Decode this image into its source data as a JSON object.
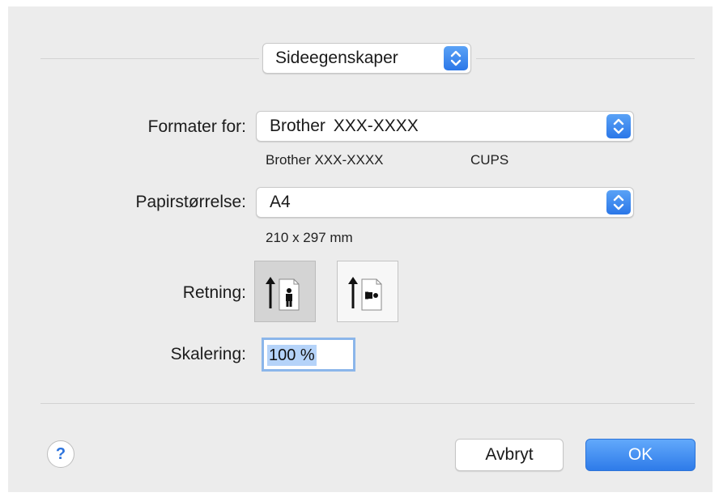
{
  "header": {
    "dropdown_label": "Sideegenskaper"
  },
  "format_for": {
    "label": "Formater for:",
    "value_brand": "Brother",
    "value_model": "XXX-XXXX",
    "subtitle_device": "Brother XXX-XXXX",
    "subtitle_driver": "CUPS"
  },
  "paper_size": {
    "label": "Papirstørrelse:",
    "value": "A4",
    "dimensions": "210 x 297 mm"
  },
  "orientation": {
    "label": "Retning:",
    "options": [
      "portrait",
      "landscape"
    ],
    "selected": "portrait"
  },
  "scaling": {
    "label": "Skalering:",
    "value": "100 %"
  },
  "buttons": {
    "help": "?",
    "cancel": "Avbryt",
    "ok": "OK"
  },
  "colors": {
    "accent": "#2e7be9",
    "background": "#ececec"
  }
}
